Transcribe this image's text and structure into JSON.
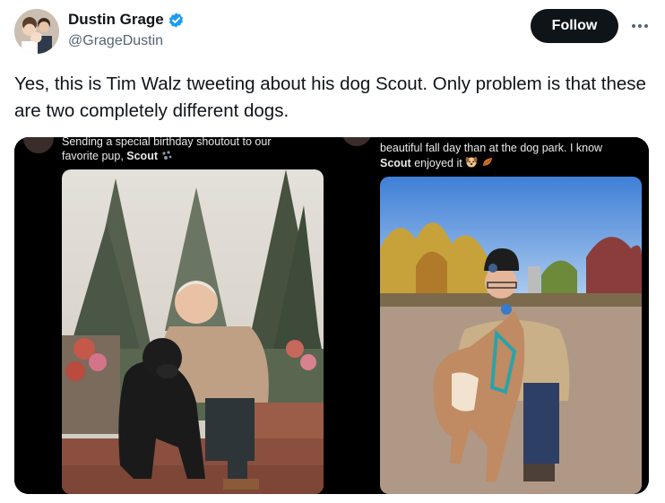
{
  "author": {
    "display_name": "Dustin Grage",
    "handle": "@GrageDustin",
    "avatar_icon": "family-avatar",
    "verified_icon": "verified-badge-icon",
    "verified_color": "#1d9bf0"
  },
  "follow_label": "Follow",
  "more_icon": "more-icon",
  "tweet_text": "Yes, this is Tim Walz tweeting about his dog Scout. Only problem is that these are two completely different dogs.",
  "media": {
    "left": {
      "caption_line1": "Sending a special birthday shoutout to our",
      "caption_line2_prefix": "favorite pup, ",
      "caption_bold": "Scout",
      "caption_icon": "paw-prints-icon"
    },
    "right": {
      "caption_line1": "beautiful fall day than at the dog park. I know",
      "caption_bold": "Scout",
      "caption_line2_suffix": " enjoyed it",
      "caption_icons": [
        "dog-face-icon",
        "fallen-leaf-icon"
      ]
    }
  }
}
